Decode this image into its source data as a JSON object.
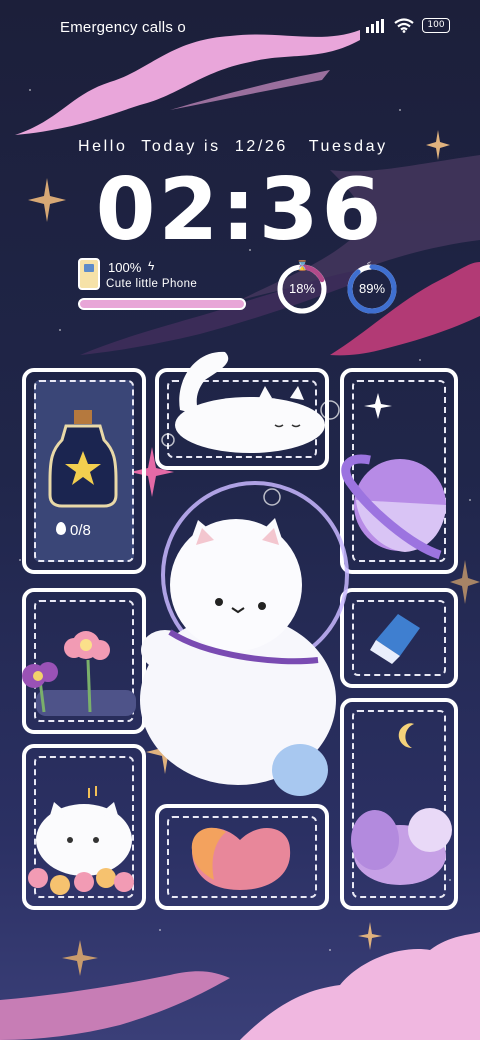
{
  "status_bar": {
    "carrier_text": "Emergency calls o",
    "battery_level": "100",
    "icons": [
      "signal-icon",
      "wifi-icon",
      "battery-icon"
    ]
  },
  "lock": {
    "greeting": "Hello  Today is  12/26   Tuesday",
    "time": "02:36"
  },
  "phone_widget": {
    "battery_percent": "100%",
    "device_name": "Cute little Phone",
    "battery_fill": 1.0,
    "icon": "phone-icon"
  },
  "rings": [
    {
      "label": "18%",
      "value": 0.18,
      "color": "#b14a8a",
      "icon": "hourglass-icon"
    },
    {
      "label": "89%",
      "value": 0.89,
      "color": "#3f6fd0",
      "icon": "moon-icon"
    }
  ],
  "water_widget": {
    "count": "0/8",
    "icon": "water-drop-icon"
  },
  "colors": {
    "background_top": "#1c1f3a",
    "background_bottom": "#3a3f78",
    "cloud_pink": "#e9a6da",
    "accent_purple": "#8f79d6"
  }
}
